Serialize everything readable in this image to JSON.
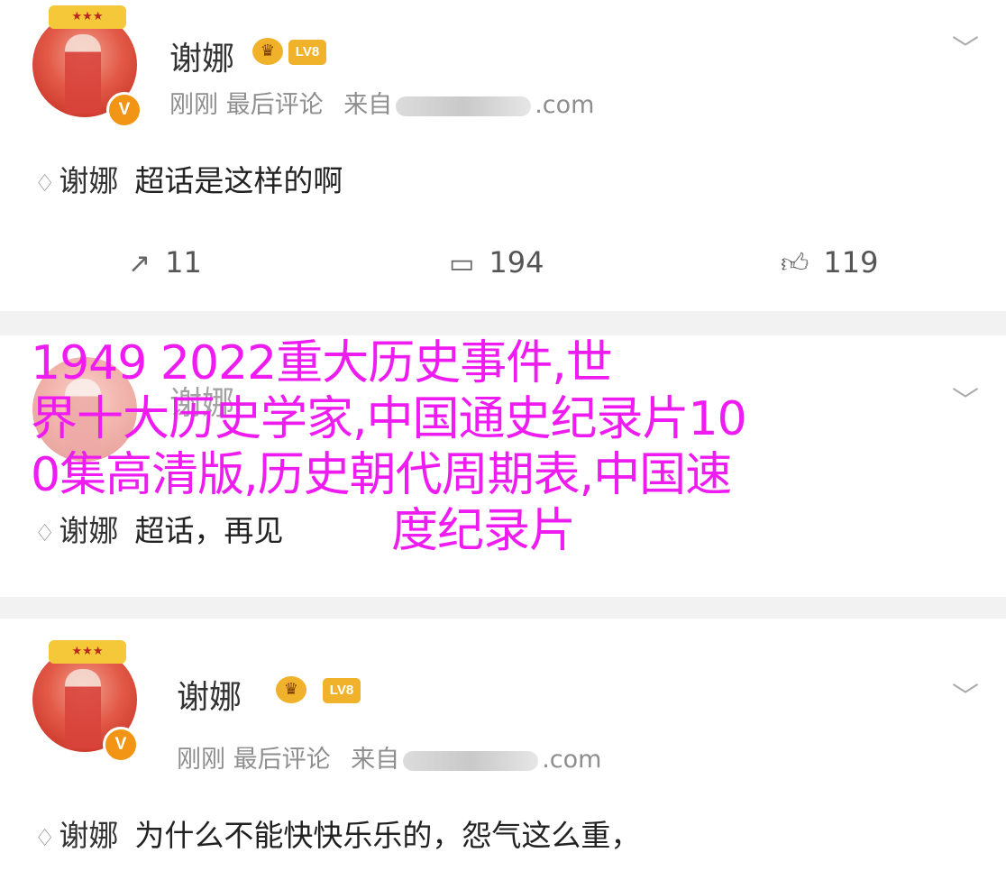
{
  "posts": [
    {
      "username": "谢娜",
      "level_badge": "LV8",
      "time": "刚刚",
      "action": "最后评论",
      "source_prefix": "来自",
      "source_suffix": ".com",
      "topic_icon": "♢",
      "topic": "谢娜",
      "text": "超话是这样的啊",
      "reposts": "11",
      "comments": "194",
      "likes": "119"
    },
    {
      "username": "谢娜",
      "topic_icon": "♢",
      "topic": "谢娜",
      "text": "超话，再见"
    },
    {
      "username": "谢娜",
      "level_badge": "LV8",
      "time": "刚刚",
      "action": "最后评论",
      "source_prefix": "来自",
      "source_suffix": ".com",
      "topic_icon": "♢",
      "topic": "谢娜",
      "text": "为什么不能快快乐乐的，怨气这么重，"
    }
  ],
  "overlay": {
    "line1": "1949 2022重大历史事件,世",
    "line2": "界十大历史学家,中国通史纪录片10",
    "line3": "0集高清版,历史朝代周期表,中国速",
    "line4": "度纪录片"
  },
  "icons": {
    "verified": "V",
    "chevron": "chevron-down-icon",
    "repost": "repost-icon",
    "comment": "comment-icon",
    "like": "thumbs-up-icon"
  },
  "colors": {
    "overlay_text": "#ee1cf0",
    "verified_badge": "#f29414",
    "background": "#f2f2f2",
    "card": "#ffffff"
  }
}
